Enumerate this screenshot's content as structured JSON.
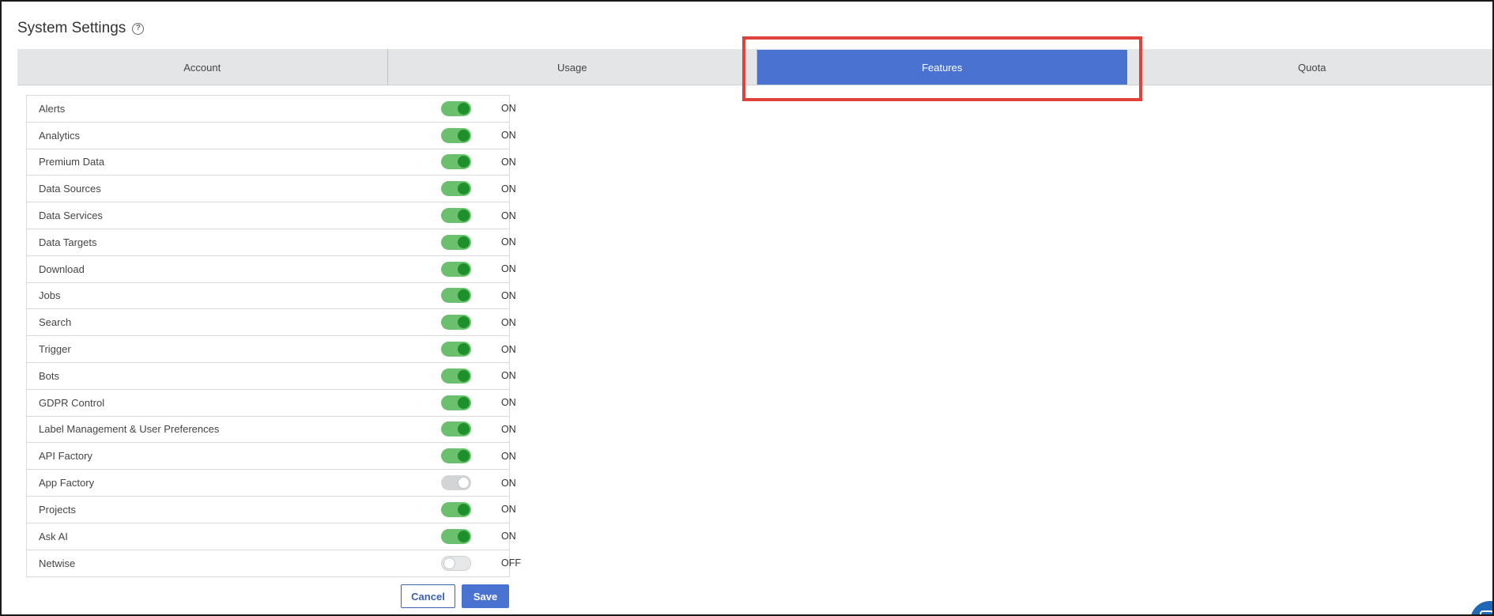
{
  "header": {
    "title": "System Settings",
    "help_icon": "help-circle-icon"
  },
  "tabs": [
    {
      "label": "Account",
      "active": false
    },
    {
      "label": "Usage",
      "active": false
    },
    {
      "label": "Features",
      "active": true
    },
    {
      "label": "Quota",
      "active": false
    }
  ],
  "features": [
    {
      "label": "Alerts",
      "state": "ON",
      "toggle": "on"
    },
    {
      "label": "Analytics",
      "state": "ON",
      "toggle": "on"
    },
    {
      "label": "Premium Data",
      "state": "ON",
      "toggle": "on"
    },
    {
      "label": "Data Sources",
      "state": "ON",
      "toggle": "on"
    },
    {
      "label": "Data Services",
      "state": "ON",
      "toggle": "on"
    },
    {
      "label": "Data Targets",
      "state": "ON",
      "toggle": "on"
    },
    {
      "label": "Download",
      "state": "ON",
      "toggle": "on"
    },
    {
      "label": "Jobs",
      "state": "ON",
      "toggle": "on"
    },
    {
      "label": "Search",
      "state": "ON",
      "toggle": "on"
    },
    {
      "label": "Trigger",
      "state": "ON",
      "toggle": "on"
    },
    {
      "label": "Bots",
      "state": "ON",
      "toggle": "on"
    },
    {
      "label": "GDPR Control",
      "state": "ON",
      "toggle": "on"
    },
    {
      "label": "Label Management & User Preferences",
      "state": "ON",
      "toggle": "on"
    },
    {
      "label": "API Factory",
      "state": "ON",
      "toggle": "on"
    },
    {
      "label": "App Factory",
      "state": "ON",
      "toggle": "disabled"
    },
    {
      "label": "Projects",
      "state": "ON",
      "toggle": "on"
    },
    {
      "label": "Ask AI",
      "state": "ON",
      "toggle": "on"
    },
    {
      "label": "Netwise",
      "state": "OFF",
      "toggle": "off"
    }
  ],
  "actions": {
    "cancel_label": "Cancel",
    "save_label": "Save"
  },
  "colors": {
    "active_tab": "#4a72d0",
    "toggle_on_track": "#6bc06d",
    "toggle_on_knob": "#1d8f2b",
    "highlight": "#e0413b"
  }
}
